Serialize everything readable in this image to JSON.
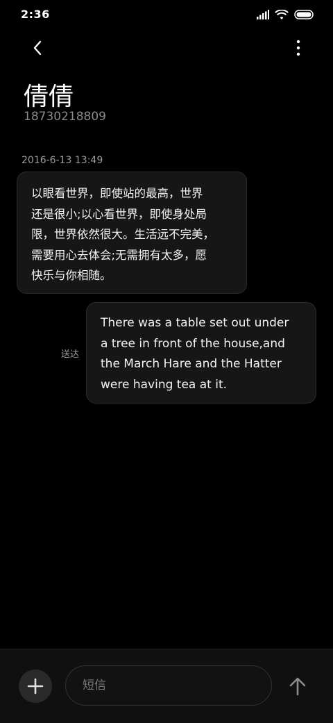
{
  "status_bar": {
    "time": "2:36"
  },
  "contact": {
    "name": "倩倩",
    "number": "18730218809"
  },
  "conversation": {
    "timestamp": "2016-6-13 13:49",
    "incoming_lines": [
      "以眼看世界，即使站的最高，世界",
      "还是很小;以心看世界，即使身处局",
      "限，世界依然很大。生活远不完美，",
      "需要用心去体会;无需拥有太多，愿",
      "快乐与你相随。"
    ],
    "outgoing_lines": [
      "There was a table set out under",
      "a tree in front of the house,and",
      "the March Hare and the Hatter",
      "were having tea at it."
    ],
    "delivered_label": "送达"
  },
  "composer": {
    "placeholder": "短信"
  },
  "icons": {
    "back": "chevron-left-icon",
    "more": "more-vertical-icon",
    "add": "plus-icon",
    "send": "arrow-up-icon"
  },
  "colors": {
    "background": "#000000",
    "bubble": "#161616",
    "secondary_text": "#8a8a8a"
  }
}
